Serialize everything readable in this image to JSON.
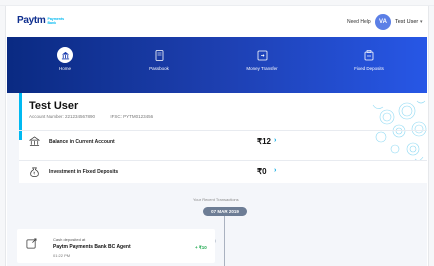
{
  "header": {
    "logo_main": "Paytm",
    "logo_sub": "Payments Bank",
    "help": "Need Help",
    "avatar_initials": "VA",
    "username": "Test User"
  },
  "nav": {
    "items": [
      {
        "label": "Home",
        "icon": "bank-icon",
        "active": true
      },
      {
        "label": "Passbook",
        "icon": "passbook-icon",
        "active": false
      },
      {
        "label": "Money Transfer",
        "icon": "money-transfer-icon",
        "active": false
      },
      {
        "label": "Fixed Deposits",
        "icon": "fixed-deposit-icon",
        "active": false
      }
    ]
  },
  "account": {
    "name": "Test User",
    "account_number": "Account Number: 221234567890",
    "ifsc": "IFSC: PYTM0123456",
    "rows": [
      {
        "label": "Balance in Current Account",
        "amount": "₹12",
        "icon": "bank-icon"
      },
      {
        "label": "Investment in Fixed Deposits",
        "amount": "₹0",
        "icon": "money-bag-icon"
      }
    ]
  },
  "transactions": {
    "title": "Your Recent Transactions",
    "date": "07 MAR 2019",
    "items": [
      {
        "small": "Cash deposited at",
        "name": "Paytm Payments Bank BC Agent",
        "time": "01:22 PM",
        "amount": "+ ₹10"
      }
    ]
  },
  "colors": {
    "brand_dark": "#0a2a82",
    "brand_light": "#2757e6",
    "accent": "#00b9f1",
    "credit": "#1fa94f"
  }
}
